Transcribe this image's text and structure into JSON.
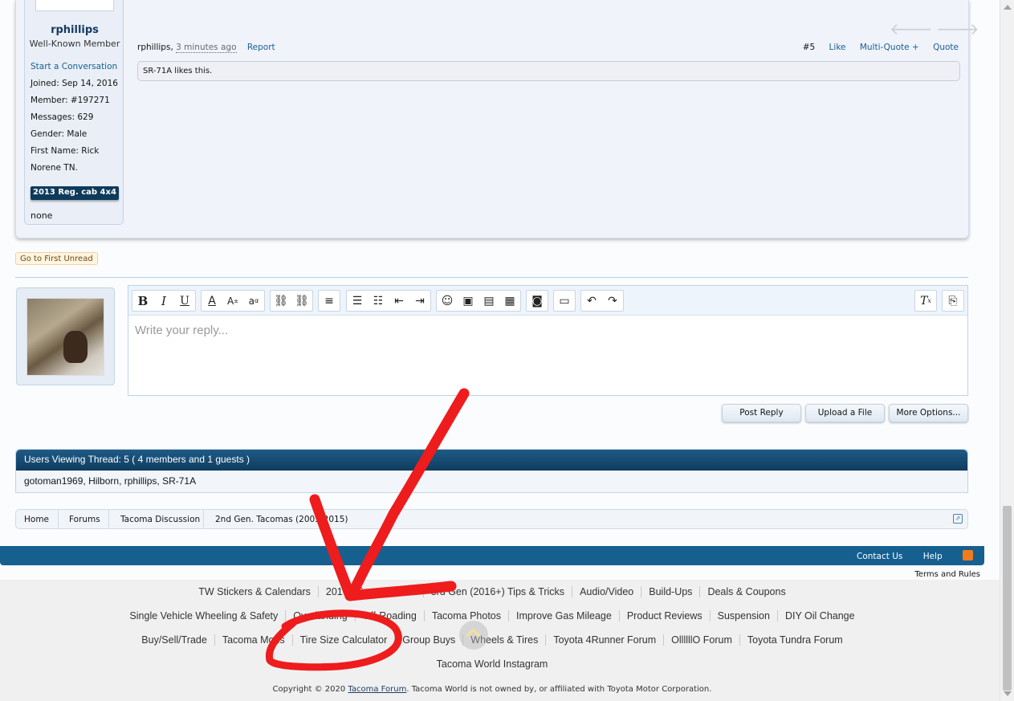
{
  "post": {
    "username": "rphillips",
    "user_title": "Well-Known Member",
    "user_info": [
      "Start a Conversation",
      "Joined: Sep 14, 2016",
      "Member: #197271",
      "Messages: 629",
      "Gender: Male",
      "First Name: Rick",
      "Norene TN."
    ],
    "truck_badge": "2013 Reg. cab 4x4",
    "extra": "none",
    "author": "rphillips,",
    "time": "3 minutes ago",
    "report": "Report",
    "post_number": "#5",
    "like": "Like",
    "multi_quote": "Multi-Quote +",
    "quote": "Quote",
    "likes_text": "SR-71A likes this."
  },
  "go_first_unread": "Go to First Unread",
  "reply": {
    "placeholder": "Write your reply...",
    "toolbar_icons": [
      "bold-icon",
      "italic-icon",
      "underline-icon",
      "text-color-icon",
      "font-size-icon",
      "font-family-icon",
      "link-icon",
      "unlink-icon",
      "align-icon",
      "bullet-list-icon",
      "numbered-list-icon",
      "outdent-icon",
      "indent-icon",
      "smilie-icon",
      "image-icon",
      "media-icon",
      "insert-icon",
      "camera-icon",
      "save-draft-icon",
      "undo-icon",
      "redo-icon",
      "remove-format-icon",
      "toggle-bbcode-icon"
    ],
    "post_reply": "Post Reply",
    "upload_file": "Upload a File",
    "more_options": "More Options..."
  },
  "viewing": {
    "header": "Users Viewing Thread: 5 ( 4 members and 1 guests )",
    "users": "gotoman1969, Hilborn, rphillips, SR-71A"
  },
  "breadcrumb": [
    "Home",
    "Forums",
    "Tacoma Discussion",
    "2nd Gen. Tacomas (2005-2015)"
  ],
  "footer": {
    "contact": "Contact Us",
    "help": "Help",
    "terms": "Terms and Rules",
    "row1": [
      "TW Stickers & Calendars",
      "2016+ Tacoma Tech",
      "3rd Gen (2016+) Tips & Tricks",
      "Audio/Video",
      "Build-Ups",
      "Deals & Coupons"
    ],
    "row2": [
      "Single Vehicle Wheeling & Safety",
      "Overlanding",
      "Off-Roading",
      "Tacoma Photos",
      "Improve Gas Mileage",
      "Product Reviews",
      "Suspension",
      "DIY Oil Change"
    ],
    "row3": [
      "Buy/Sell/Trade",
      "Tacoma Mods",
      "Tire Size Calculator",
      "Group Buys",
      "Wheels & Tires",
      "Toyota 4Runner Forum",
      "OllllllO Forum",
      "Toyota Tundra Forum"
    ],
    "row4": [
      "Tacoma World Instagram"
    ],
    "copyright_pre": "Copyright © 2020",
    "copyright_link": "Tacoma Forum",
    "copyright_post": ". Tacoma World is not owned by, or affiliated with Toyota Motor Corporation."
  },
  "colors": {
    "accent": "#15608f",
    "header_dark": "#103c5e",
    "annotation_red": "#ee1c1c"
  }
}
